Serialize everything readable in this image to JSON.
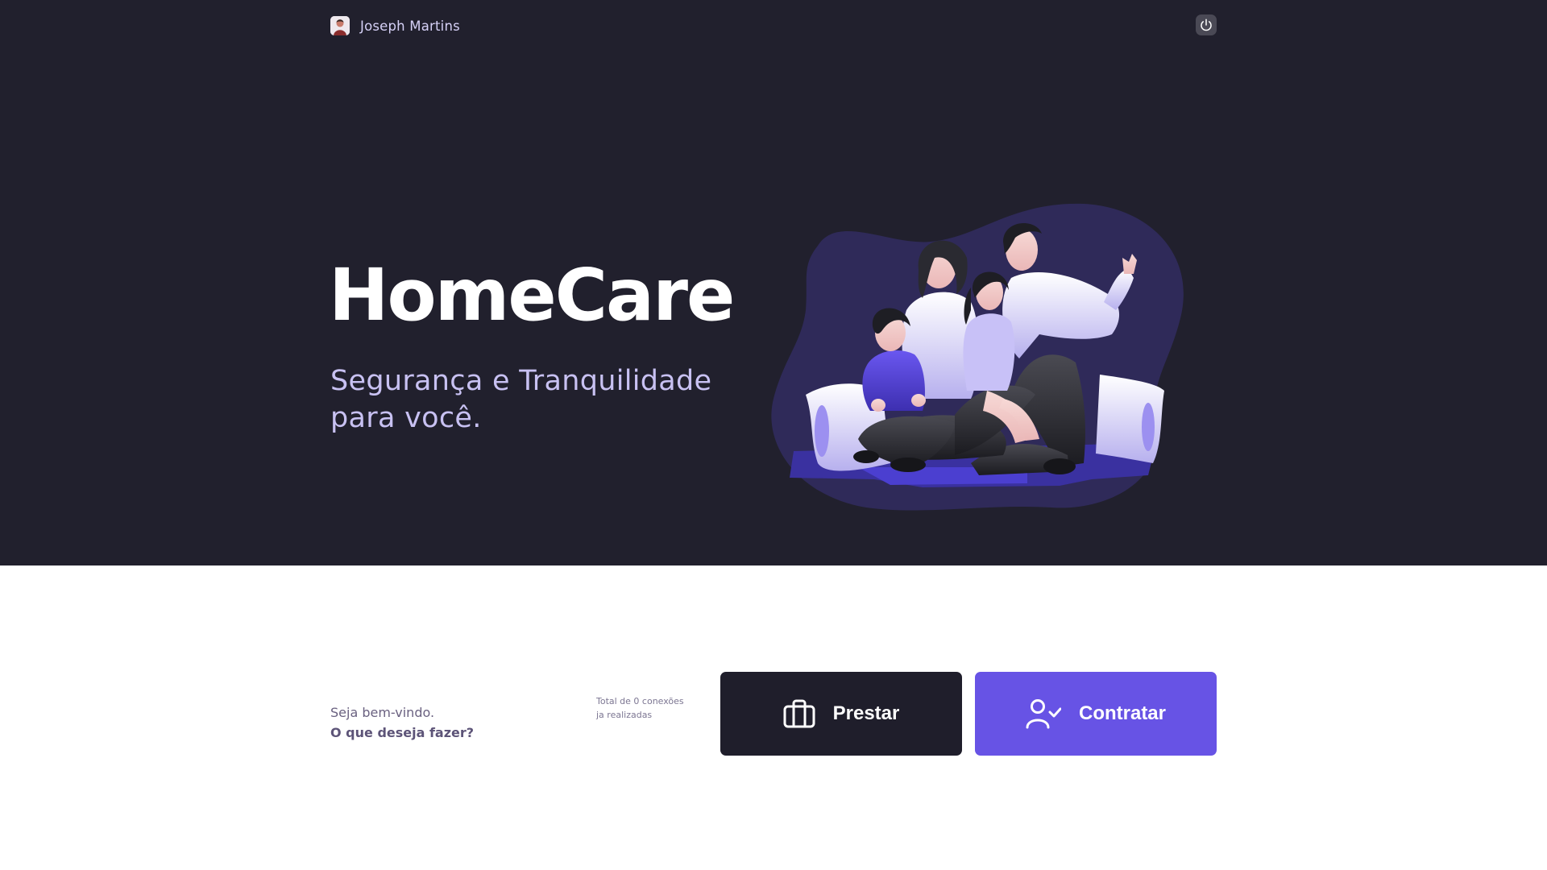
{
  "header": {
    "user_name": "Joseph Martins",
    "icons": {
      "avatar": "user-photo",
      "logout": "power-icon"
    }
  },
  "hero": {
    "title": "HomeCare",
    "subtitle": "Segurança e Tranquilidade para você.",
    "illustration": "family-sitting-illustration"
  },
  "welcome": {
    "greeting": "Seja bem-vindo.",
    "question": "O que deseja fazer?"
  },
  "connections": {
    "line1": "Total de 0 conexões",
    "line2": "ja realizadas"
  },
  "actions": {
    "prestar": {
      "label": "Prestar",
      "icon": "briefcase-icon"
    },
    "contratar": {
      "label": "Contratar",
      "icon": "user-check-icon"
    }
  },
  "colors": {
    "hero_background": "#21202d",
    "accent": "#6753e5",
    "dark_button": "#1f1e2b",
    "subtitle": "#c8c1f2"
  }
}
